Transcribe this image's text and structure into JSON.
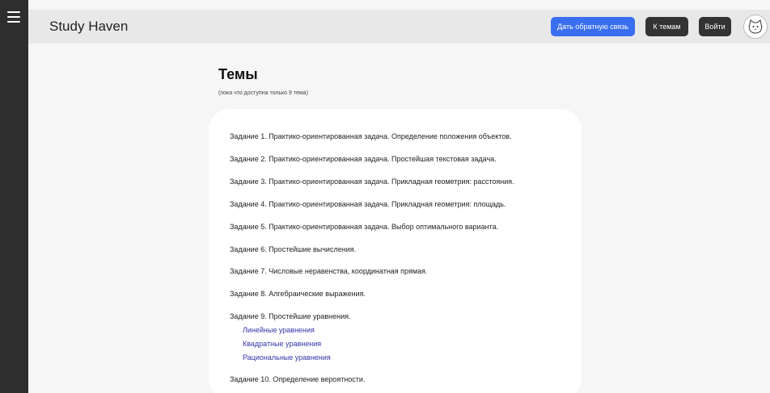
{
  "header": {
    "brand": "Study Haven",
    "feedback_button": "Дать обратную связь",
    "topics_button": "К темам",
    "login_button": "Войти"
  },
  "icons": {
    "menu": "menu-icon",
    "avatar": "cat-avatar-icon"
  },
  "colors": {
    "accent": "#3a6ef0",
    "dark": "#2e2e2e",
    "link": "#3535a8"
  },
  "main": {
    "title": "Темы",
    "subtitle": "(пока что доступна только 9 тема)",
    "tasks": [
      "Задание 1. Практико-ориентированная задача. Определение положения объектов.",
      "Задание 2. Практико-ориентированная задача. Простейшая текстовая задача.",
      "Задание 3. Практико-ориентированная задача. Прикладная геометрия: расстояния.",
      "Задание 4. Практико-ориентированная задача. Прикладная геометрия: площадь.",
      "Задание 5. Практико-ориентированная задача. Выбор оптимального варианта.",
      "Задание 6. Простейшие вычисления.",
      "Задание 7. Числовые неравенства, координатная прямая.",
      "Задание 8. Алгебраические выражения.",
      "Задание 9. Простейшие уравнения.",
      "Задание 10. Определение вероятности."
    ],
    "task9_subtopics": [
      "Линейные уравнения",
      "Квадратные уравнения",
      "Рациональные уравнения"
    ]
  }
}
